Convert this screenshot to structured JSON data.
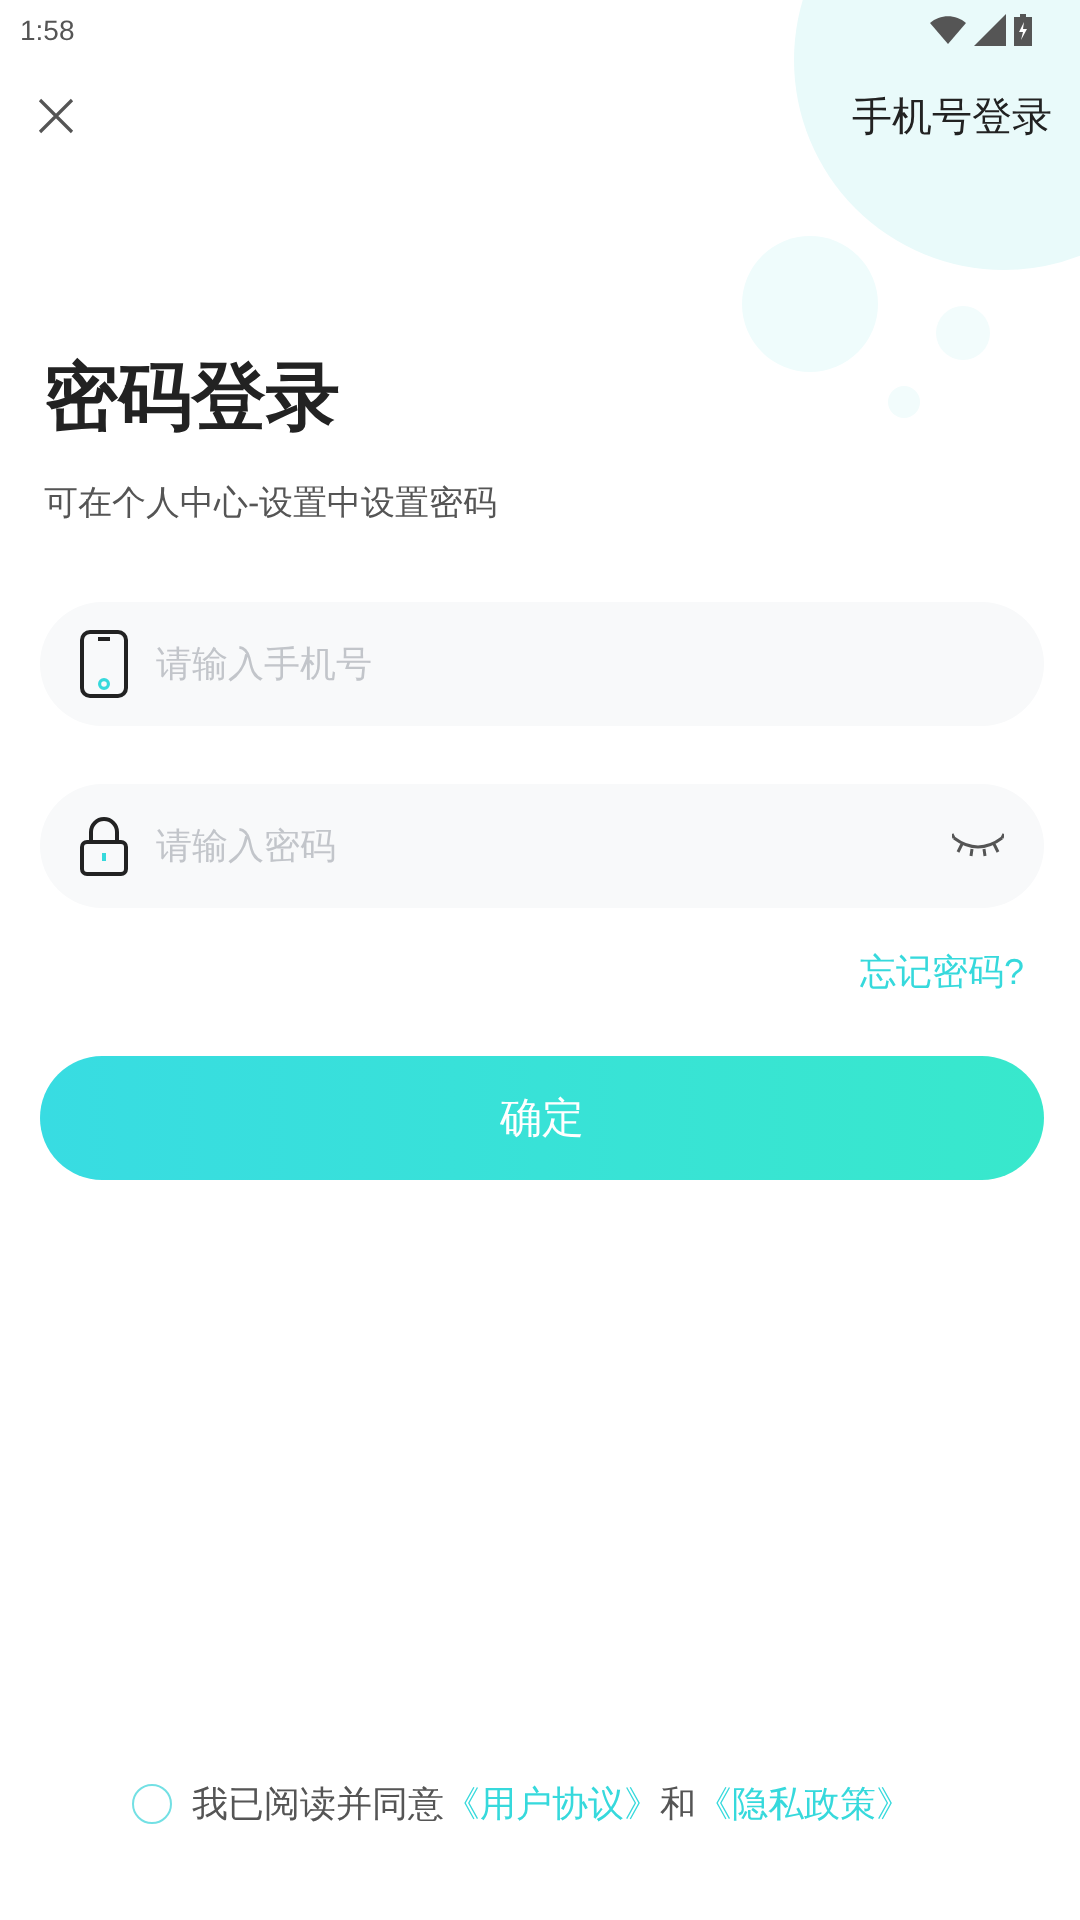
{
  "status_bar": {
    "time": "1:58"
  },
  "header": {
    "switch_link": "手机号登录"
  },
  "title": "密码登录",
  "subtitle": "可在个人中心-设置中设置密码",
  "fields": [
    {
      "kind": "phone",
      "placeholder": "请输入手机号"
    },
    {
      "kind": "password",
      "placeholder": "请输入密码",
      "revealed": false
    }
  ],
  "forgot_link": "忘记密码?",
  "submit_button": "确定",
  "agreement": {
    "checked": false,
    "parts": [
      {
        "kind": "text",
        "text": "我已阅读并同意"
      },
      {
        "kind": "link",
        "text": "《用户协议》"
      },
      {
        "kind": "text",
        "text": "和"
      },
      {
        "kind": "link",
        "text": "《隐私政策》"
      }
    ]
  }
}
